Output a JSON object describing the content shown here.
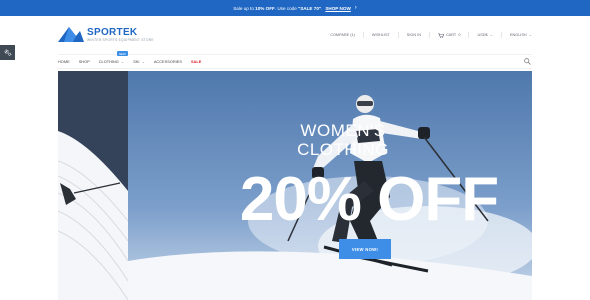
{
  "promo_bar": {
    "text_prefix": "Sale up to ",
    "highlight": "10% OFF",
    "text_middle": ". Use code ",
    "code": "\"SALE 70\"",
    "text_end": ".",
    "link_label": "SHOP NOW",
    "chevron": "›"
  },
  "brand": {
    "name": "SPORTEK",
    "tagline": "WINTER SPORTS EQUIPMENT STORE"
  },
  "utility_nav": [
    {
      "label": "COMPARE (1)",
      "caret": ""
    },
    {
      "label": "WISHLIST",
      "caret": ""
    },
    {
      "label": "SIGN IN",
      "caret": ""
    },
    {
      "label": "CART",
      "count": "0",
      "caret": ""
    },
    {
      "label": "USD$",
      "caret": "⌄"
    },
    {
      "label": "ENGLISH",
      "caret": "⌄"
    }
  ],
  "main_nav": [
    {
      "label": "HOME",
      "caret": ""
    },
    {
      "label": "SHOP",
      "caret": ""
    },
    {
      "label": "CLOTHING",
      "caret": "⌄",
      "badge": "NEW"
    },
    {
      "label": "SKI",
      "caret": "⌄"
    },
    {
      "label": "ACCESSORIES",
      "caret": ""
    },
    {
      "label": "SALE",
      "caret": ""
    }
  ],
  "hero": {
    "title_line1": "WOMEN'S",
    "title_line2": "CLOTHING",
    "discount": "20% OFF",
    "cta_label": "VIEW NOW!"
  },
  "colors": {
    "brand_blue": "#1f67c2",
    "cta_blue": "#3e8ee8",
    "sale_red": "#d9252c",
    "settings_dark": "#3f4a55"
  },
  "icons": {
    "cart": "cart-icon",
    "search": "search-icon",
    "settings": "gear-icon",
    "logo": "mountain-logo-icon"
  }
}
